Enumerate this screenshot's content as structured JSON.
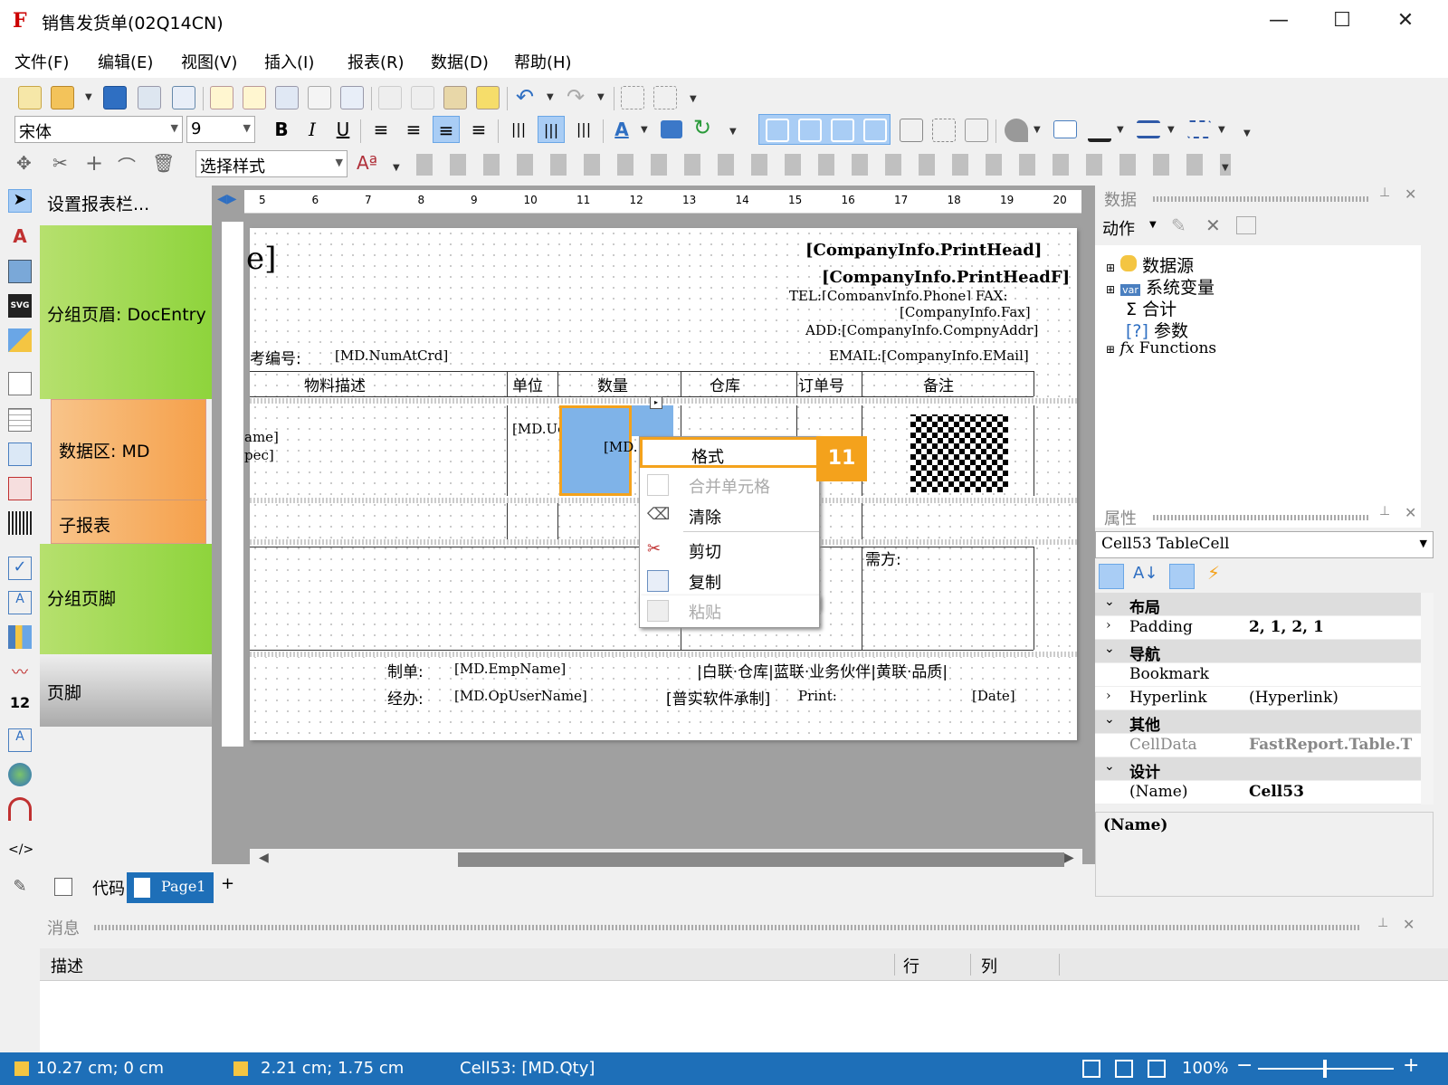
{
  "title": "销售发货单(02Q14CN)",
  "menu": [
    "文件(F)",
    "编辑(E)",
    "视图(V)",
    "插入(I)",
    "报表(R)",
    "数据(D)",
    "帮助(H)"
  ],
  "toolbar": {
    "font": "宋体",
    "size": "9",
    "style": "选择样式"
  },
  "bands": {
    "header": "设置报表栏...",
    "group_header": "分组页眉: DocEntry",
    "data": "数据区: MD",
    "subreport": "子报表",
    "group_footer": "分组页脚",
    "footer": "页脚"
  },
  "ruler": [
    "5",
    "6",
    "7",
    "8",
    "9",
    "10",
    "11",
    "12",
    "13",
    "14",
    "15",
    "16",
    "17",
    "18",
    "19",
    "20"
  ],
  "report": {
    "head1": "[CompanyInfo.PrintHead]",
    "head2": "[CompanyInfo.PrintHeadF]",
    "tel": "TEL:[CompanyInfo.Phone]  FAX:",
    "fax": "[CompanyInfo.Fax]",
    "addr": "ADD:[CompanyInfo.CompnyAddr]",
    "email": "EMAIL:[CompanyInfo.EMail]",
    "ref_label": "考编号:",
    "ref_val": "[MD.NumAtCrd]",
    "col1": "物料描述",
    "col2": "单位",
    "col3": "数量",
    "col4": "仓库",
    "col5": "订单号",
    "col6": "备注",
    "cell_name": "ame]",
    "cell_spec": "pec]",
    "cell_uom": "[MD.UomName]",
    "cell_qty": "[MD.",
    "buyer": "需方:",
    "maker_label": "制单:",
    "maker_val": "[MD.EmpName]",
    "handler_label": "经办:",
    "handler_val": "[MD.OpUserName]",
    "copies": "|白联·仓库|蓝联·业务伙伴|黄联·品质|",
    "software": "[普实软件承制]",
    "print": "Print:",
    "date": "[Date]",
    "bracket": "e]"
  },
  "context_menu": {
    "format": "格式",
    "merge": "合并单元格",
    "clear": "清除",
    "cut": "剪切",
    "copy": "复制",
    "paste": "粘贴"
  },
  "callout": "11",
  "data_panel": {
    "title": "数据",
    "action": "动作",
    "items": [
      "数据源",
      "系统变量",
      "合计",
      "参数",
      "Functions"
    ]
  },
  "props": {
    "title": "属性",
    "object": "Cell53 TableCell",
    "layout": "布局",
    "padding_k": "Padding",
    "padding_v": "2, 1, 2, 1",
    "nav": "导航",
    "bookmark": "Bookmark",
    "hyperlink_k": "Hyperlink",
    "hyperlink_v": "(Hyperlink)",
    "other": "其他",
    "celldata_k": "CellData",
    "celldata_v": "FastReport.Table.T",
    "design": "设计",
    "name_k": "(Name)",
    "name_v": "Cell53",
    "desc": "(Name)"
  },
  "tabs": {
    "code": "代码",
    "page": "Page1",
    "add": "+"
  },
  "messages": {
    "title": "消息",
    "desc": "描述",
    "row": "行",
    "col": "列"
  },
  "status": {
    "pos": "10.27 cm; 0 cm",
    "size": "2.21 cm; 1.75 cm",
    "cell": "Cell53:  [MD.Qty]",
    "zoom": "100%"
  }
}
